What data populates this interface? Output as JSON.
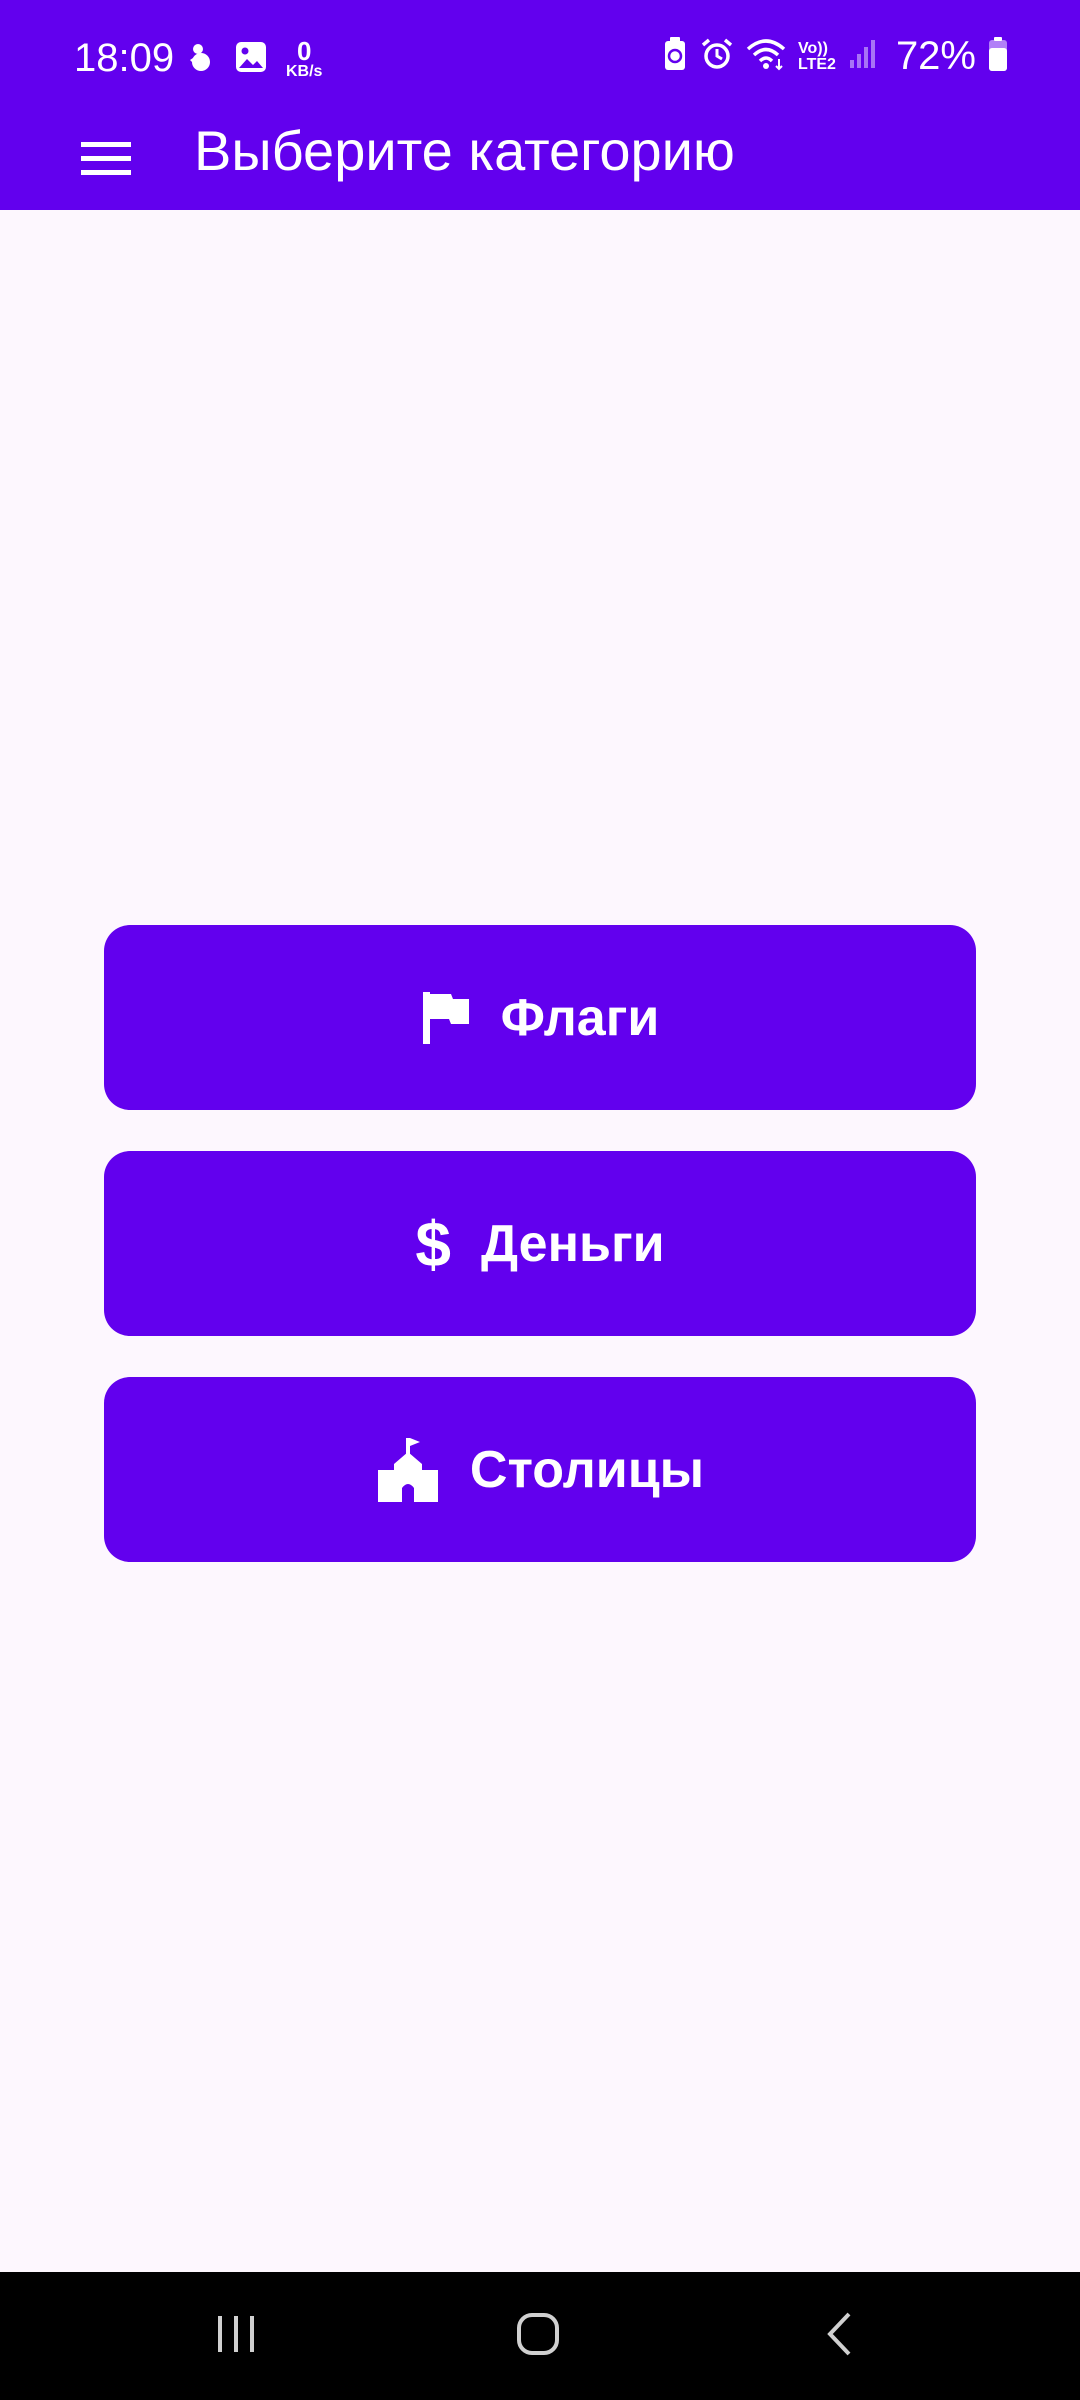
{
  "status_bar": {
    "time": "18:09",
    "net_speed_value": "0",
    "net_speed_unit": "KB/s",
    "lte_top": "Vo))",
    "lte_bottom": "LTE2",
    "battery": "72%"
  },
  "app_bar": {
    "title": "Выберите категорию",
    "menu_icon": "hamburger-menu-icon"
  },
  "categories": [
    {
      "label": "Флаги",
      "icon": "flag-icon"
    },
    {
      "label": "Деньги",
      "icon": "dollar-icon",
      "glyph": "$"
    },
    {
      "label": "Столицы",
      "icon": "school-building-icon"
    }
  ],
  "colors": {
    "primary": "#6200EE",
    "background": "#FDF7FE",
    "on_primary": "#FFFFFF",
    "nav_bar": "#000000"
  },
  "nav": {
    "recents_icon": "recents-icon",
    "home_icon": "home-icon",
    "back_icon": "back-icon"
  }
}
